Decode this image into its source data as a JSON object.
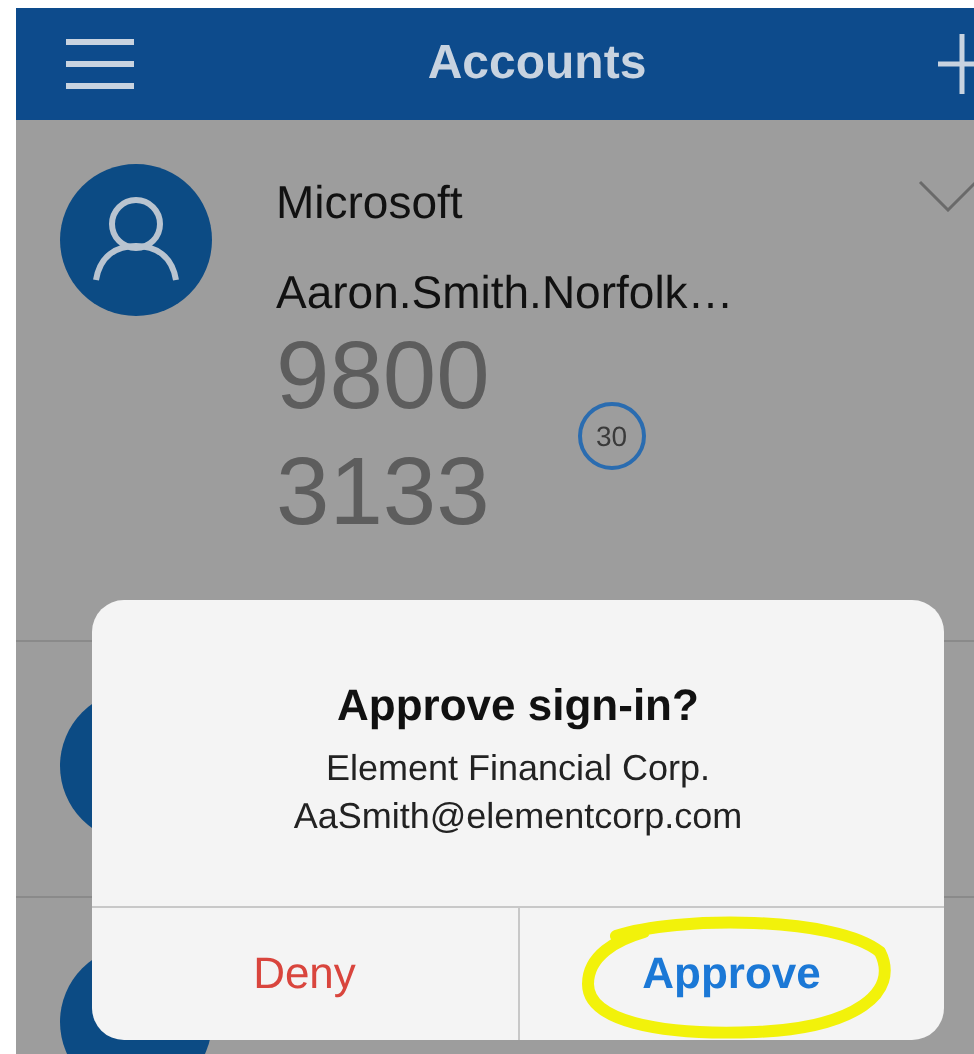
{
  "header": {
    "title": "Accounts"
  },
  "account": {
    "provider": "Microsoft",
    "user": "Aaron.Smith.Norfolk…",
    "code": [
      "9800",
      "3133"
    ],
    "timer": "30"
  },
  "dialog": {
    "title": "Approve sign-in?",
    "lines": [
      "Element Financial Corp.",
      "AaSmith@elementcorp.com"
    ],
    "buttons": [
      {
        "label": "Deny",
        "kind": "destructive",
        "highlighted": false
      },
      {
        "label": "Approve",
        "kind": "default",
        "highlighted": true
      }
    ]
  }
}
